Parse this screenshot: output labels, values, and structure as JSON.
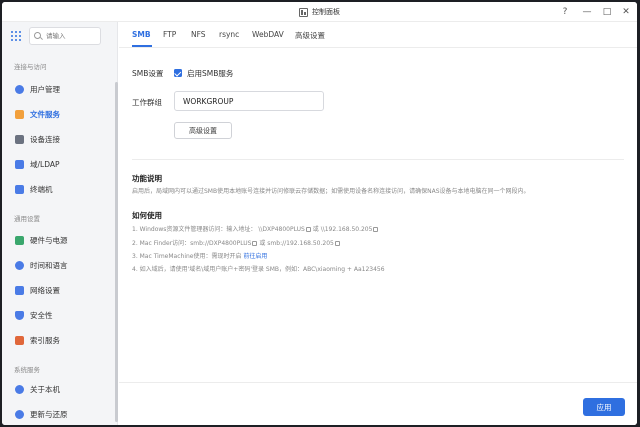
{
  "window": {
    "title": "控制面板"
  },
  "window_controls": {
    "help": "?",
    "minimize": "—",
    "maximize": "□",
    "close": "✕"
  },
  "sidebar": {
    "search_placeholder": "请输入",
    "sections": [
      {
        "label": "连接与访问",
        "items": [
          "用户管理",
          "文件服务",
          "设备连接",
          "域/LDAP",
          "终端机"
        ]
      },
      {
        "label": "通用设置",
        "items": [
          "硬件与电源",
          "时间和语言",
          "网络设置",
          "安全性",
          "索引服务"
        ]
      },
      {
        "label": "系统服务",
        "items": [
          "关于本机",
          "更新与还原"
        ]
      }
    ],
    "active_item": "文件服务",
    "icon_colors": [
      "#4a7be6",
      "#f2a03c",
      "#6b7280",
      "#4a7be6",
      "#4a7be6",
      "#3aa76d",
      "#4a7be6",
      "#4a7be6",
      "#4a7be6",
      "#e0673a",
      "#4a7be6",
      "#4a7be6"
    ]
  },
  "tabs": [
    "SMB",
    "FTP",
    "NFS",
    "rsync",
    "WebDAV",
    "高级设置"
  ],
  "active_tab": "SMB",
  "smb": {
    "setting_label": "SMB设置",
    "enable_label": "启用SMB服务",
    "enabled": true,
    "workgroup_label": "工作群组",
    "workgroup_value": "WORKGROUP",
    "advanced_button": "高级设置"
  },
  "info": {
    "title": "功能说明",
    "description": "启用后，局域网内可以通过SMB使用本地账号连接并访问修联云存储数据；如需使用设备名称连接访问，请确保NAS设备与本地电脑在同一个网段内。"
  },
  "howto": {
    "title": "如何使用",
    "steps": [
      {
        "text": "1. Windows资源文件管理器访问：输入地址： \\\\DXP4800PLUS",
        "or": " 或 ",
        "alt": "\\\\192.168.50.205"
      },
      {
        "text": "2. Mac Finder访问：smb://DXP4800PLUS",
        "or": " 或 ",
        "alt": "smb://192.168.50.205"
      },
      {
        "text": "3. Mac TimeMachine使用：需现时开启",
        "link": "前往启用"
      },
      {
        "text": "4. 如入域后，请使用'域名\\域用户账户+密码'登录 SMB，例如：ABC\\xiaoming + Aa123456"
      }
    ]
  },
  "apply_button": "应用",
  "colors": {
    "accent": "#2f6fe0"
  }
}
